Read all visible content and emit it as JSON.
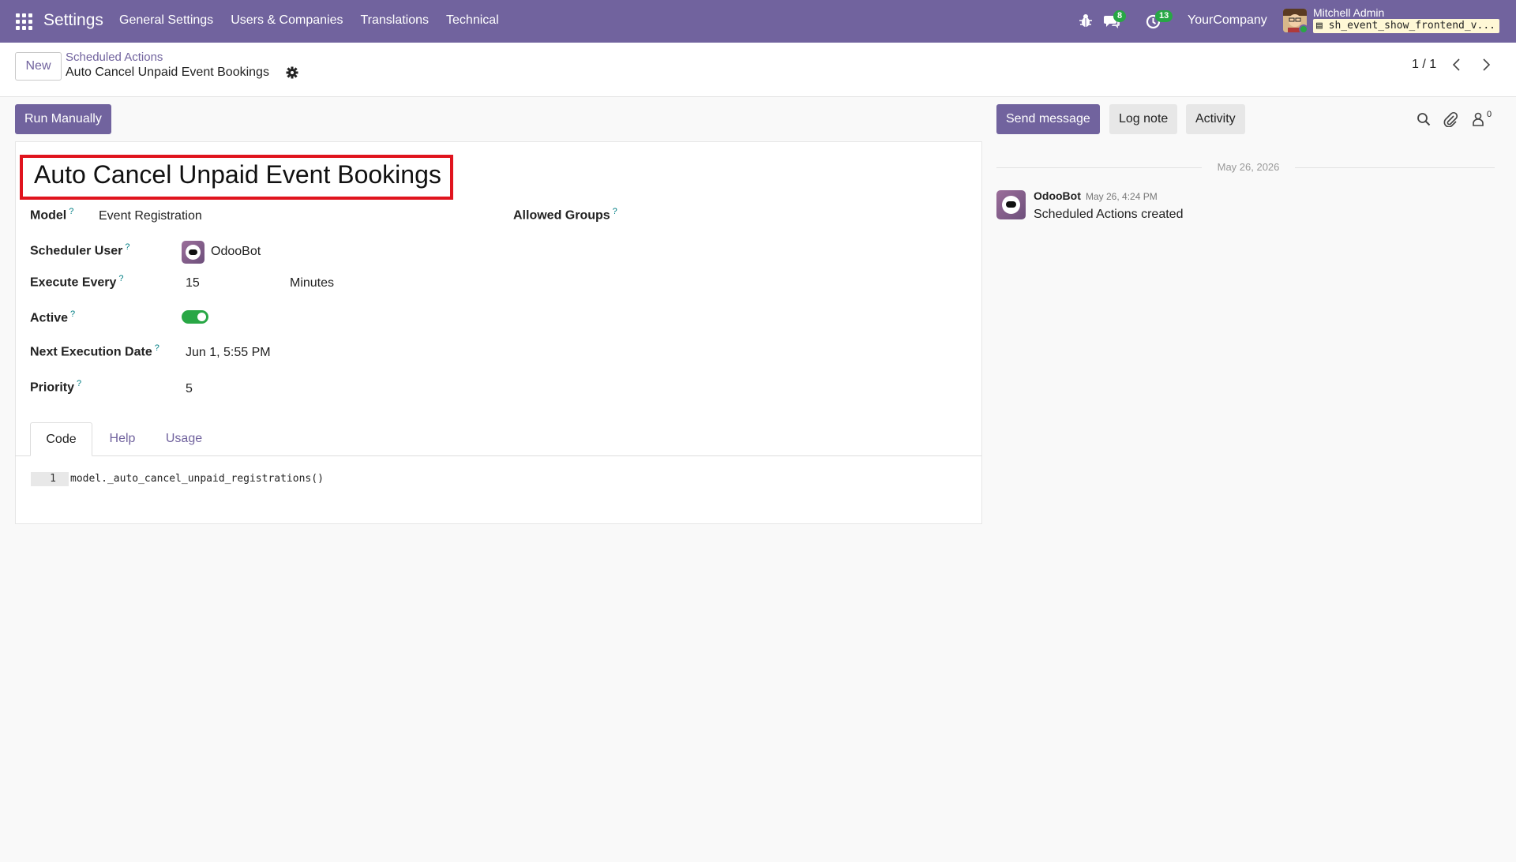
{
  "navbar": {
    "app_name": "Settings",
    "menu": [
      "General Settings",
      "Users & Companies",
      "Translations",
      "Technical"
    ],
    "chat_badge": "8",
    "activity_badge": "13",
    "company": "YourCompany",
    "user_name": "Mitchell Admin",
    "database": "sh_event_show_frontend_v..."
  },
  "control": {
    "new_label": "New",
    "breadcrumb_parent": "Scheduled Actions",
    "breadcrumb_current": "Auto Cancel Unpaid Event Bookings",
    "pager": "1 / 1"
  },
  "actions": {
    "run_manually": "Run Manually",
    "send_message": "Send message",
    "log_note": "Log note",
    "activity": "Activity",
    "follower_count": "0"
  },
  "form": {
    "title": "Auto Cancel Unpaid Event Bookings",
    "model_label": "Model",
    "model_value": "Event Registration",
    "allowed_groups_label": "Allowed Groups",
    "scheduler_user_label": "Scheduler User",
    "scheduler_user_value": "OdooBot",
    "execute_every_label": "Execute Every",
    "execute_every_value": "15",
    "execute_every_unit": "Minutes",
    "active_label": "Active",
    "active_value": true,
    "next_exec_label": "Next Execution Date",
    "next_exec_value": "Jun 1, 5:55 PM",
    "priority_label": "Priority",
    "priority_value": "5",
    "help_marker": "?"
  },
  "tabs": [
    {
      "label": "Code",
      "active": true
    },
    {
      "label": "Help",
      "active": false
    },
    {
      "label": "Usage",
      "active": false
    }
  ],
  "code": {
    "line_number": "1",
    "line": "model._auto_cancel_unpaid_registrations()"
  },
  "chatter": {
    "date_separator": "May 26, 2026",
    "message_author": "OdooBot",
    "message_date": "May 26, 4:24 PM",
    "message_body": "Scheduled Actions created"
  },
  "colors": {
    "brand": "#71639e",
    "success": "#28a745",
    "highlight": "#e0141e"
  }
}
